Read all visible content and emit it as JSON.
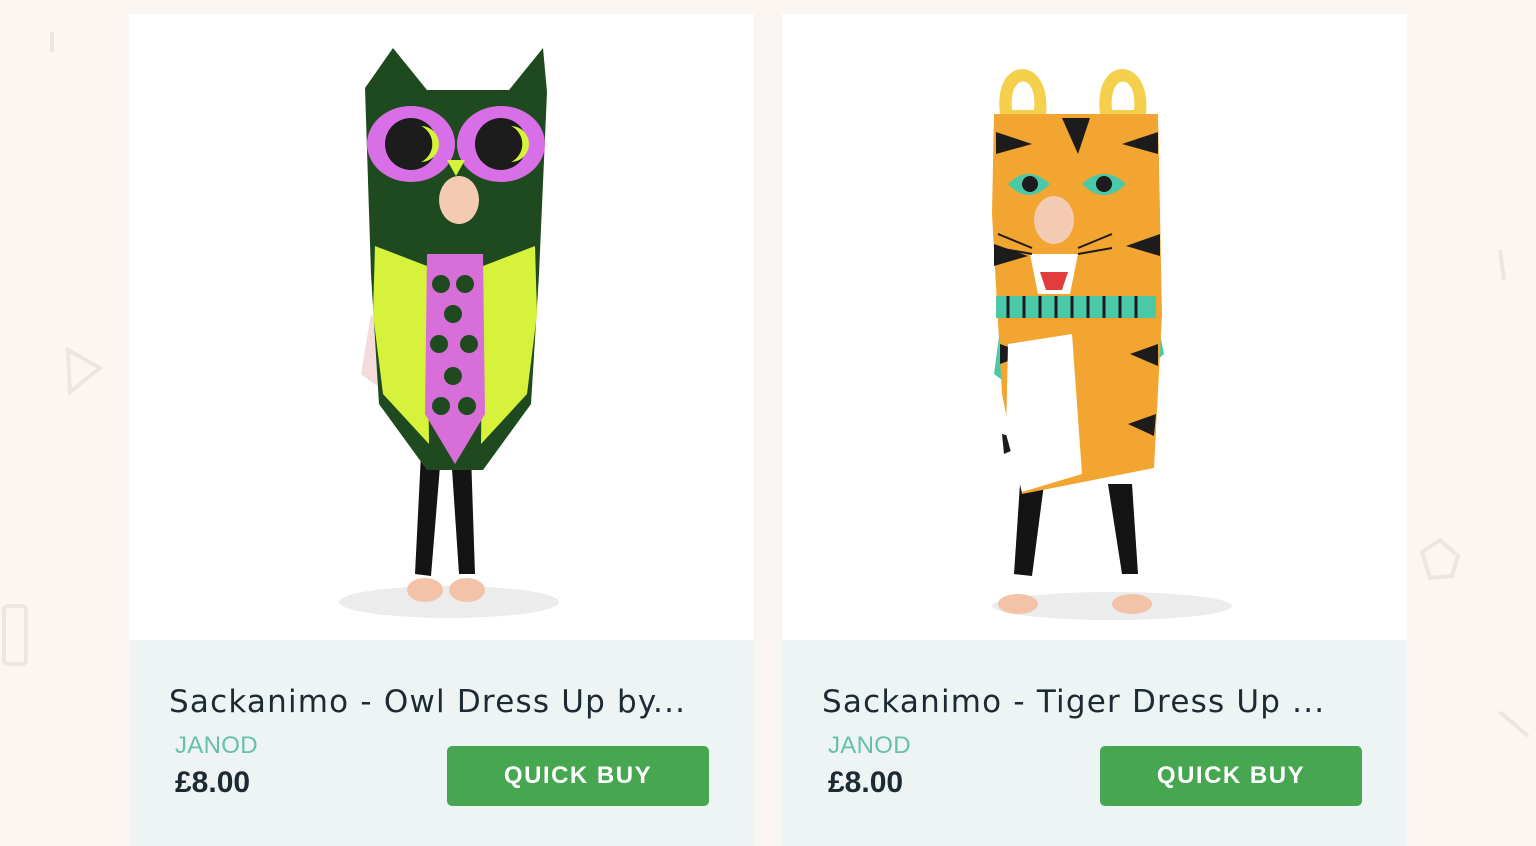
{
  "products": [
    {
      "title": "Sackanimo - Owl Dress Up by...",
      "brand": "JANOD",
      "price": "£8.00",
      "button_label": "QUICK BUY",
      "image_label": "owl-costume-photo"
    },
    {
      "title": "Sackanimo - Tiger Dress Up ...",
      "brand": "JANOD",
      "price": "£8.00",
      "button_label": "QUICK BUY",
      "image_label": "tiger-costume-photo"
    }
  ],
  "colors": {
    "page_bg": "#fbf6f1",
    "info_bg": "#eef4f4",
    "brand": "#66c2a5",
    "button": "#46a750",
    "text": "#1d2a33"
  }
}
